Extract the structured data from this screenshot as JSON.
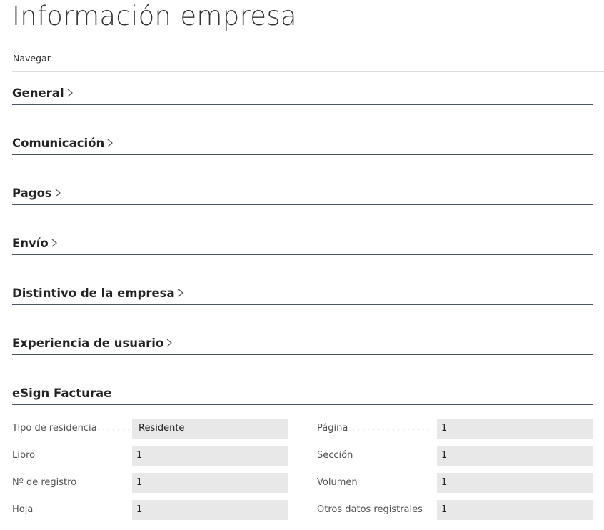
{
  "page": {
    "title": "Información empresa"
  },
  "actionbar": {
    "navigate_label": "Navegar"
  },
  "sections": [
    {
      "label": "General"
    },
    {
      "label": "Comunicación"
    },
    {
      "label": "Pagos"
    },
    {
      "label": "Envío"
    },
    {
      "label": "Distintivo de la empresa"
    },
    {
      "label": "Experiencia de usuario"
    },
    {
      "label": "eSign Facturae"
    }
  ],
  "esign": {
    "left": [
      {
        "label": "Tipo de residencia",
        "value": "Residente"
      },
      {
        "label": "Libro",
        "value": "1"
      },
      {
        "label": "Nº de registro",
        "value": "1"
      },
      {
        "label": "Hoja",
        "value": "1"
      }
    ],
    "right": [
      {
        "label": "Página",
        "value": "1"
      },
      {
        "label": "Sección",
        "value": "1"
      },
      {
        "label": "Volumen",
        "value": "1"
      },
      {
        "label": "Otros datos registrales",
        "value": "1"
      }
    ]
  }
}
